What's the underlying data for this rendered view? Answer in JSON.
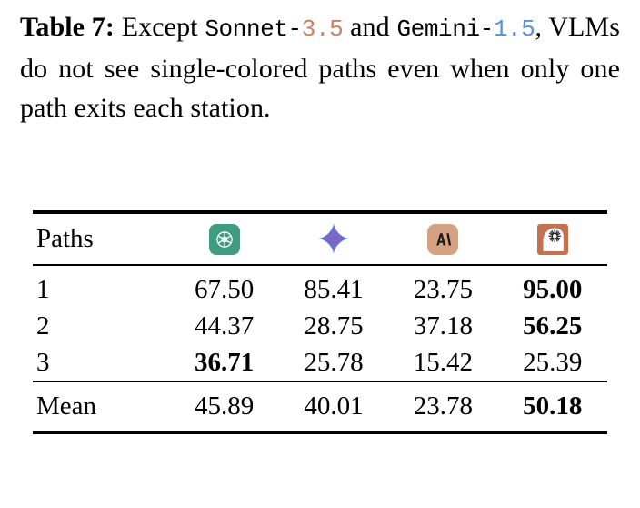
{
  "caption": {
    "label": "Table 7:",
    "part1": "Except",
    "model1_name": "Sonnet-",
    "model1_version": "3.5",
    "conjunction": "and",
    "model2_name": "Gemini-",
    "model2_version": "1.5",
    "part2": ", VLMs do not see single-colored paths even when only one path exits each station.",
    "version1_color": "#CD7F63",
    "version2_color": "#5B8FD9"
  },
  "table": {
    "columns": [
      {
        "label": "Paths",
        "icon": null
      },
      {
        "label": "",
        "icon": "openai-logo-icon"
      },
      {
        "label": "",
        "icon": "gemini-star-icon"
      },
      {
        "label": "",
        "icon": "claude-logo-icon"
      },
      {
        "label": "",
        "icon": "llava-head-icon"
      }
    ],
    "rows": [
      {
        "label": "1",
        "values": [
          "67.50",
          "85.41",
          "23.75",
          "95.00"
        ],
        "bold": [
          false,
          false,
          false,
          true
        ]
      },
      {
        "label": "2",
        "values": [
          "44.37",
          "28.75",
          "37.18",
          "56.25"
        ],
        "bold": [
          false,
          false,
          false,
          true
        ]
      },
      {
        "label": "3",
        "values": [
          "36.71",
          "25.78",
          "15.42",
          "25.39"
        ],
        "bold": [
          true,
          false,
          false,
          false
        ]
      }
    ],
    "summary": {
      "label": "Mean",
      "values": [
        "45.89",
        "40.01",
        "23.78",
        "50.18"
      ],
      "bold": [
        false,
        false,
        false,
        true
      ]
    }
  },
  "icon_colors": {
    "openai_bg": "#3E9C7F",
    "gemini_blue": "#4285F4",
    "gemini_purple": "#8B5FBF",
    "claude_bg": "#D5A183",
    "claude_glyph": "#1F1B17",
    "llava_bg": "#C4714F",
    "llava_head": "#FFFFFF"
  }
}
